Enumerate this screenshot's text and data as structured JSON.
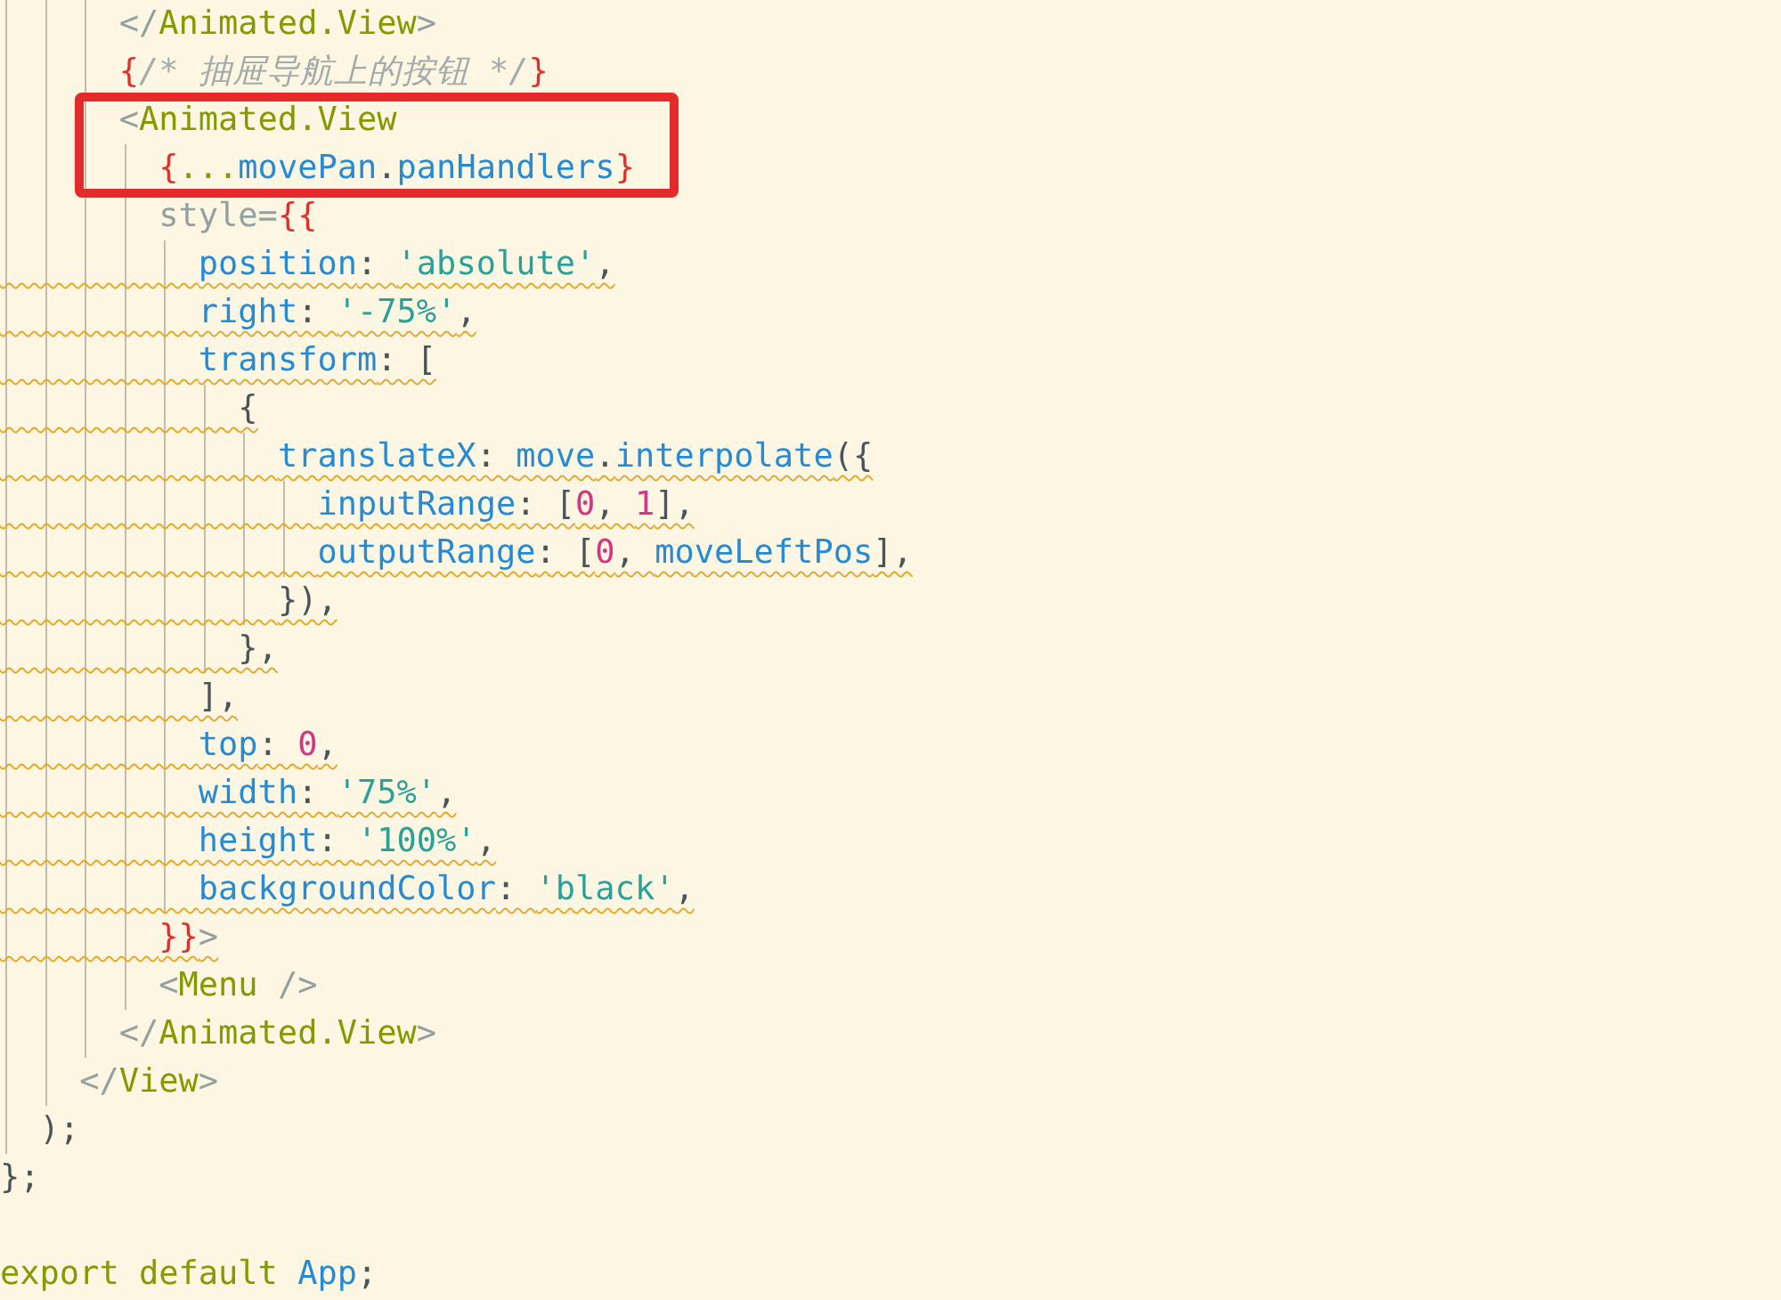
{
  "editor": {
    "lines": [
      {
        "warning": false,
        "tokens": [
          {
            "kind": "bracket",
            "text": "      </"
          },
          {
            "kind": "tag",
            "text": "Animated.View"
          },
          {
            "kind": "bracket",
            "text": ">"
          }
        ]
      },
      {
        "warning": false,
        "tokens": [
          {
            "kind": "brace",
            "text": "      {"
          },
          {
            "kind": "comment",
            "text": "/* 抽屉导航上的按钮 */"
          },
          {
            "kind": "brace",
            "text": "}"
          }
        ]
      },
      {
        "warning": false,
        "tokens": [
          {
            "kind": "bracket",
            "text": "      <"
          },
          {
            "kind": "tag",
            "text": "Animated.View"
          }
        ]
      },
      {
        "warning": false,
        "tokens": [
          {
            "kind": "brace",
            "text": "        {"
          },
          {
            "kind": "tag",
            "text": "..."
          },
          {
            "kind": "prop",
            "text": "movePan"
          },
          {
            "kind": "punct",
            "text": "."
          },
          {
            "kind": "prop",
            "text": "panHandlers"
          },
          {
            "kind": "brace",
            "text": "}"
          }
        ]
      },
      {
        "warning": false,
        "tokens": [
          {
            "kind": "bracket",
            "text": "        style="
          },
          {
            "kind": "brace",
            "text": "{{"
          }
        ]
      },
      {
        "warning": true,
        "tokens": [
          {
            "kind": "prop",
            "text": "          position"
          },
          {
            "kind": "punct",
            "text": ": "
          },
          {
            "kind": "string",
            "text": "'absolute'"
          },
          {
            "kind": "punct",
            "text": ","
          }
        ]
      },
      {
        "warning": true,
        "tokens": [
          {
            "kind": "prop",
            "text": "          right"
          },
          {
            "kind": "punct",
            "text": ": "
          },
          {
            "kind": "string",
            "text": "'-75%'"
          },
          {
            "kind": "punct",
            "text": ","
          }
        ]
      },
      {
        "warning": true,
        "tokens": [
          {
            "kind": "prop",
            "text": "          transform"
          },
          {
            "kind": "punct",
            "text": ": ["
          }
        ]
      },
      {
        "warning": true,
        "tokens": [
          {
            "kind": "punct",
            "text": "            {"
          }
        ]
      },
      {
        "warning": true,
        "tokens": [
          {
            "kind": "prop",
            "text": "              translateX"
          },
          {
            "kind": "punct",
            "text": ": "
          },
          {
            "kind": "prop",
            "text": "move"
          },
          {
            "kind": "punct",
            "text": "."
          },
          {
            "kind": "prop",
            "text": "interpolate"
          },
          {
            "kind": "punct",
            "text": "({"
          }
        ]
      },
      {
        "warning": true,
        "tokens": [
          {
            "kind": "prop",
            "text": "                inputRange"
          },
          {
            "kind": "punct",
            "text": ": ["
          },
          {
            "kind": "number",
            "text": "0"
          },
          {
            "kind": "punct",
            "text": ", "
          },
          {
            "kind": "number",
            "text": "1"
          },
          {
            "kind": "punct",
            "text": "],"
          }
        ]
      },
      {
        "warning": true,
        "tokens": [
          {
            "kind": "prop",
            "text": "                outputRange"
          },
          {
            "kind": "punct",
            "text": ": ["
          },
          {
            "kind": "number",
            "text": "0"
          },
          {
            "kind": "punct",
            "text": ", "
          },
          {
            "kind": "prop",
            "text": "moveLeftPos"
          },
          {
            "kind": "punct",
            "text": "],"
          }
        ]
      },
      {
        "warning": true,
        "tokens": [
          {
            "kind": "punct",
            "text": "              }),"
          }
        ]
      },
      {
        "warning": true,
        "tokens": [
          {
            "kind": "punct",
            "text": "            },"
          }
        ]
      },
      {
        "warning": true,
        "tokens": [
          {
            "kind": "punct",
            "text": "          ],"
          }
        ]
      },
      {
        "warning": true,
        "tokens": [
          {
            "kind": "prop",
            "text": "          top"
          },
          {
            "kind": "punct",
            "text": ": "
          },
          {
            "kind": "number",
            "text": "0"
          },
          {
            "kind": "punct",
            "text": ","
          }
        ]
      },
      {
        "warning": true,
        "tokens": [
          {
            "kind": "prop",
            "text": "          width"
          },
          {
            "kind": "punct",
            "text": ": "
          },
          {
            "kind": "string",
            "text": "'75%'"
          },
          {
            "kind": "punct",
            "text": ","
          }
        ]
      },
      {
        "warning": true,
        "tokens": [
          {
            "kind": "prop",
            "text": "          height"
          },
          {
            "kind": "punct",
            "text": ": "
          },
          {
            "kind": "string",
            "text": "'100%'"
          },
          {
            "kind": "punct",
            "text": ","
          }
        ]
      },
      {
        "warning": true,
        "tokens": [
          {
            "kind": "prop",
            "text": "          backgroundColor"
          },
          {
            "kind": "punct",
            "text": ": "
          },
          {
            "kind": "string",
            "text": "'black'"
          },
          {
            "kind": "punct",
            "text": ","
          }
        ]
      },
      {
        "warning": true,
        "tokens": [
          {
            "kind": "brace",
            "text": "        }}"
          },
          {
            "kind": "bracket",
            "text": ">"
          }
        ]
      },
      {
        "warning": false,
        "tokens": [
          {
            "kind": "bracket",
            "text": "        <"
          },
          {
            "kind": "tag",
            "text": "Menu"
          },
          {
            "kind": "bracket",
            "text": " />"
          }
        ]
      },
      {
        "warning": false,
        "tokens": [
          {
            "kind": "bracket",
            "text": "      </"
          },
          {
            "kind": "tag",
            "text": "Animated.View"
          },
          {
            "kind": "bracket",
            "text": ">"
          }
        ]
      },
      {
        "warning": false,
        "tokens": [
          {
            "kind": "bracket",
            "text": "    </"
          },
          {
            "kind": "tag",
            "text": "View"
          },
          {
            "kind": "bracket",
            "text": ">"
          }
        ]
      },
      {
        "warning": false,
        "tokens": [
          {
            "kind": "punct",
            "text": "  );"
          }
        ]
      },
      {
        "warning": false,
        "tokens": [
          {
            "kind": "punct",
            "text": "};"
          }
        ]
      },
      {
        "warning": false,
        "tokens": [
          {
            "kind": "tag",
            "text": "export default "
          },
          {
            "kind": "prop",
            "text": "App"
          },
          {
            "kind": "punct",
            "text": ";"
          }
        ]
      }
    ]
  }
}
